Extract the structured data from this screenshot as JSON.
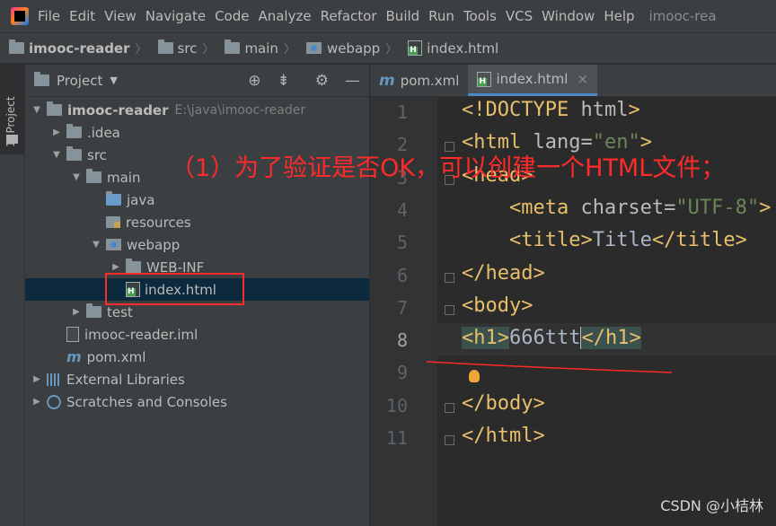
{
  "menubar": {
    "items": [
      "File",
      "Edit",
      "View",
      "Navigate",
      "Code",
      "Analyze",
      "Refactor",
      "Build",
      "Run",
      "Tools",
      "VCS",
      "Window",
      "Help"
    ],
    "title": "imooc-rea"
  },
  "navbar": {
    "crumbs": [
      "imooc-reader",
      "src",
      "main",
      "webapp",
      "index.html"
    ]
  },
  "leftstrip": {
    "tab_label": "1: Project"
  },
  "project": {
    "title": "Project",
    "tree": [
      {
        "label": "imooc-reader",
        "path": "E:\\java\\imooc-reader",
        "indent": 0,
        "arrow": "▼",
        "icon": "module-folder-icon",
        "bold": true
      },
      {
        "label": ".idea",
        "indent": 1,
        "arrow": "▶",
        "icon": "folder-icon"
      },
      {
        "label": "src",
        "indent": 1,
        "arrow": "▼",
        "icon": "folder-icon"
      },
      {
        "label": "main",
        "indent": 2,
        "arrow": "▼",
        "icon": "folder-icon"
      },
      {
        "label": "java",
        "indent": 3,
        "arrow": "",
        "icon": "source-folder-icon"
      },
      {
        "label": "resources",
        "indent": 3,
        "arrow": "",
        "icon": "resources-folder-icon"
      },
      {
        "label": "webapp",
        "indent": 3,
        "arrow": "▼",
        "icon": "web-folder-icon"
      },
      {
        "label": "WEB-INF",
        "indent": 4,
        "arrow": "▶",
        "icon": "folder-icon"
      },
      {
        "label": "index.html",
        "indent": 4,
        "arrow": "",
        "icon": "html-file-icon",
        "selected": true
      },
      {
        "label": "test",
        "indent": 2,
        "arrow": "▶",
        "icon": "folder-icon"
      },
      {
        "label": "imooc-reader.iml",
        "indent": 1,
        "arrow": "",
        "icon": "iml-file-icon"
      },
      {
        "label": "pom.xml",
        "indent": 1,
        "arrow": "",
        "icon": "maven-file-icon"
      },
      {
        "label": "External Libraries",
        "indent": 0,
        "arrow": "▶",
        "icon": "libraries-icon"
      },
      {
        "label": "Scratches and Consoles",
        "indent": 0,
        "arrow": "▶",
        "icon": "scratches-icon"
      }
    ]
  },
  "editor": {
    "tabs": [
      {
        "label": "pom.xml",
        "icon": "maven-file-icon",
        "active": false
      },
      {
        "label": "index.html",
        "icon": "html-file-icon",
        "active": true
      }
    ],
    "line_numbers": [
      "1",
      "2",
      "3",
      "4",
      "5",
      "6",
      "7",
      "8",
      "9",
      "10",
      "11"
    ],
    "current_line": "8",
    "lines": [
      "<!DOCTYPE html>",
      "<html lang=\"en\">",
      "<head>",
      "    <meta charset=\"UTF-8\">",
      "    <title>Title</title>",
      "</head>",
      "<body>",
      "<h1>666ttt</h1>",
      "",
      "</body>",
      "</html>"
    ]
  },
  "annotation": {
    "text": "（1）为了验证是否OK，可以创建一个HTML文件；",
    "color": "#ff2a2a"
  },
  "watermark": "CSDN @小桔林",
  "colors": {
    "accent": "#4a88c7",
    "selection": "#0d293e",
    "tag": "#e8bf6a",
    "string": "#6a8759",
    "text": "#a9b7c6"
  }
}
